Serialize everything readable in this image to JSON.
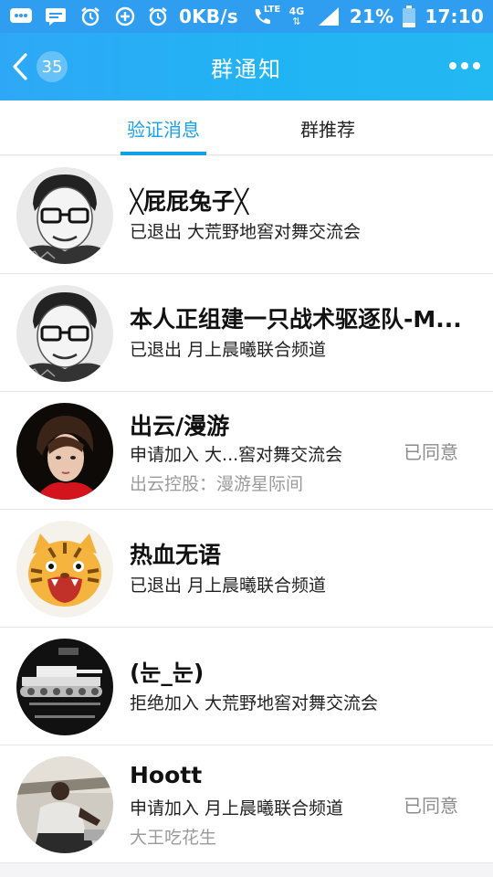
{
  "status_bar": {
    "network_speed": "0KB/s",
    "network_type": "4G",
    "lte": "LTE",
    "battery": "21%",
    "time": "17:10"
  },
  "header": {
    "back_count": "35",
    "title": "群通知"
  },
  "tabs": [
    {
      "label": "验证消息",
      "active": true
    },
    {
      "label": "群推荐",
      "active": false
    }
  ],
  "notifications": [
    {
      "name": "╳屁屁兔子╳",
      "desc": "已退出 大荒野地窖对舞交流会",
      "sub": "",
      "status": "",
      "avatar": "man-glasses-sketch-avatar"
    },
    {
      "name": "本人正组建一只战术驱逐队-M...",
      "desc": "已退出 月上晨曦联合频道",
      "sub": "",
      "status": "",
      "avatar": "man-glasses-sketch-avatar"
    },
    {
      "name": "出云/漫游",
      "desc": "申请加入 大...窖对舞交流会",
      "sub": "出云控股：漫游星际间",
      "status": "已同意",
      "avatar": "red-shirt-portrait-avatar"
    },
    {
      "name": "热血无语",
      "desc": "已退出 月上晨曦联合频道",
      "sub": "",
      "status": "",
      "avatar": "cartoon-tiger-avatar"
    },
    {
      "name": "(눈_눈)",
      "desc": "拒绝加入 大荒野地窖对舞交流会",
      "sub": "",
      "status": "",
      "avatar": "tank-meme-avatar"
    },
    {
      "name": "Hoott",
      "desc": "申请加入 月上晨曦联合频道",
      "sub": "大王吃花生",
      "status": "已同意",
      "avatar": "man-on-bench-photo-avatar"
    }
  ],
  "colors": {
    "header_start": "#2ea8f6",
    "header_end": "#22b8f2",
    "accent": "#12a1e6",
    "muted": "#9a9a9a"
  }
}
